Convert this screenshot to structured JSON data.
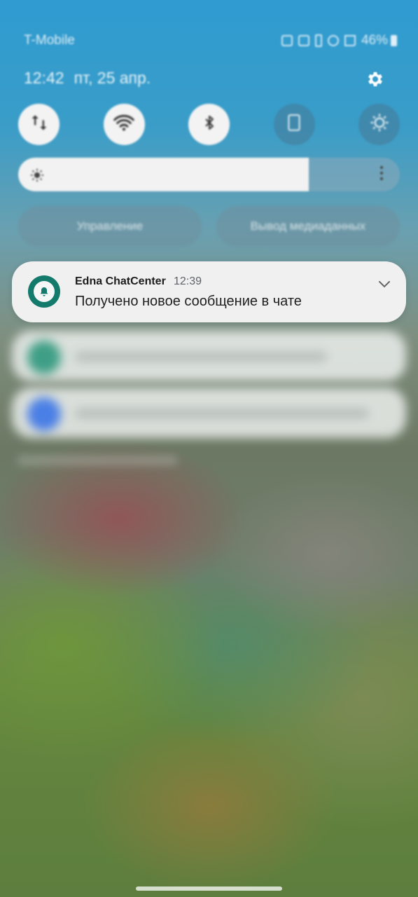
{
  "status_bar": {
    "carrier": "T-Mobile",
    "battery": "46%",
    "icons": [
      "nfc-icon",
      "alarm-icon",
      "vibrate-icon",
      "wifi-call-icon",
      "signal-icon",
      "battery-icon"
    ]
  },
  "quick_panel": {
    "time": "12:42",
    "date": "пт, 25 апр.",
    "tiles": [
      {
        "name": "mobile-data-icon",
        "state": "on"
      },
      {
        "name": "wifi-icon",
        "state": "on"
      },
      {
        "name": "bluetooth-icon",
        "state": "on"
      },
      {
        "name": "document-icon",
        "state": "off"
      },
      {
        "name": "brightness-mode-icon",
        "state": "off"
      }
    ],
    "brightness_level": 0.76,
    "device_control_label": "Управление",
    "media_output_label": "Вывод медиаданных"
  },
  "notification": {
    "app_name": "Edna ChatCenter",
    "time": "12:39",
    "message": "Получено новое сообщение в чате",
    "icon_color": "#137a6c"
  },
  "blurred_notifications": [
    {
      "icon_color": "#3f9f86"
    },
    {
      "icon_color": "#4a7fe6"
    }
  ]
}
